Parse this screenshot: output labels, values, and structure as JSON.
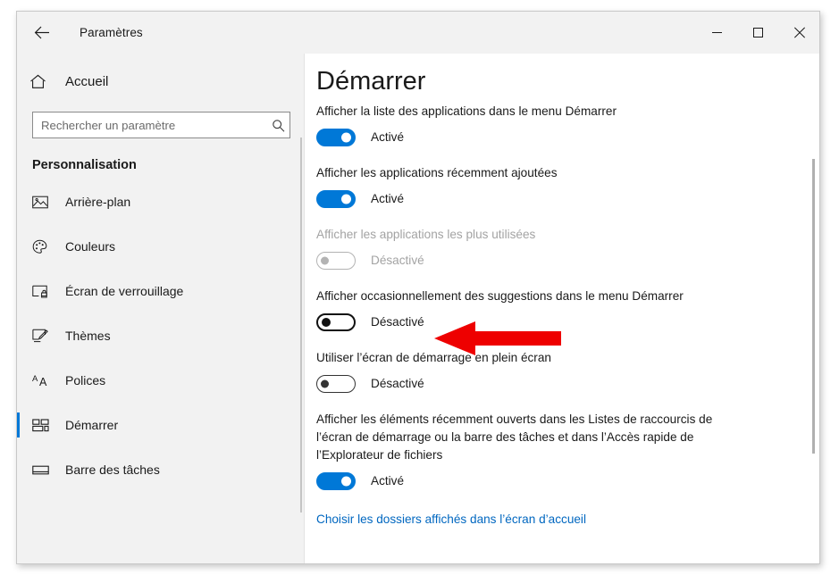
{
  "window": {
    "title": "Paramètres",
    "back_icon": "back-arrow-icon",
    "minimize_label": "—",
    "maximize_label": "□",
    "close_label": "✕"
  },
  "sidebar": {
    "home": {
      "label": "Accueil",
      "icon": "home-icon"
    },
    "search": {
      "placeholder": "Rechercher un paramètre",
      "value": "",
      "icon": "search-icon"
    },
    "section_title": "Personnalisation",
    "items": [
      {
        "label": "Arrière-plan",
        "icon": "image-icon",
        "active": false
      },
      {
        "label": "Couleurs",
        "icon": "palette-icon",
        "active": false
      },
      {
        "label": "Écran de verrouillage",
        "icon": "lock-screen-icon",
        "active": false
      },
      {
        "label": "Thèmes",
        "icon": "brush-icon",
        "active": false
      },
      {
        "label": "Polices",
        "icon": "font-aa-icon",
        "active": false
      },
      {
        "label": "Démarrer",
        "icon": "start-tiles-icon",
        "active": true
      },
      {
        "label": "Barre des tâches",
        "icon": "taskbar-icon",
        "active": false
      }
    ]
  },
  "main": {
    "page_title": "Démarrer",
    "settings": [
      {
        "description": "Afficher la liste des applications dans le menu Démarrer",
        "state_label": "Activé",
        "state": "on",
        "disabled": false
      },
      {
        "description": "Afficher les applications récemment ajoutées",
        "state_label": "Activé",
        "state": "on",
        "disabled": false
      },
      {
        "description": "Afficher les applications les plus utilisées",
        "state_label": "Désactivé",
        "state": "off",
        "disabled": true
      },
      {
        "description": "Afficher occasionnellement des suggestions dans le menu Démarrer",
        "state_label": "Désactivé",
        "state": "off",
        "disabled": false
      },
      {
        "description": "Utiliser l’écran de démarrage en plein écran",
        "state_label": "Désactivé",
        "state": "off",
        "disabled": false
      },
      {
        "description": "Afficher les éléments récemment ouverts dans les Listes de raccourcis de l’écran de démarrage ou la barre des tâches et dans l’Accès rapide de l’Explorateur de fichiers",
        "state_label": "Activé",
        "state": "on",
        "disabled": false
      }
    ],
    "link": "Choisir les dossiers affichés dans l’écran d’accueil"
  },
  "annotation": {
    "name": "red-arrow-pointer",
    "color": "#ee0000",
    "points_to": "Désactivé"
  },
  "colors": {
    "accent": "#0078d7",
    "link": "#0067c0",
    "sidebar_bg": "#f2f2f2",
    "main_bg": "#ffffff",
    "annotation_red": "#ee0000"
  }
}
